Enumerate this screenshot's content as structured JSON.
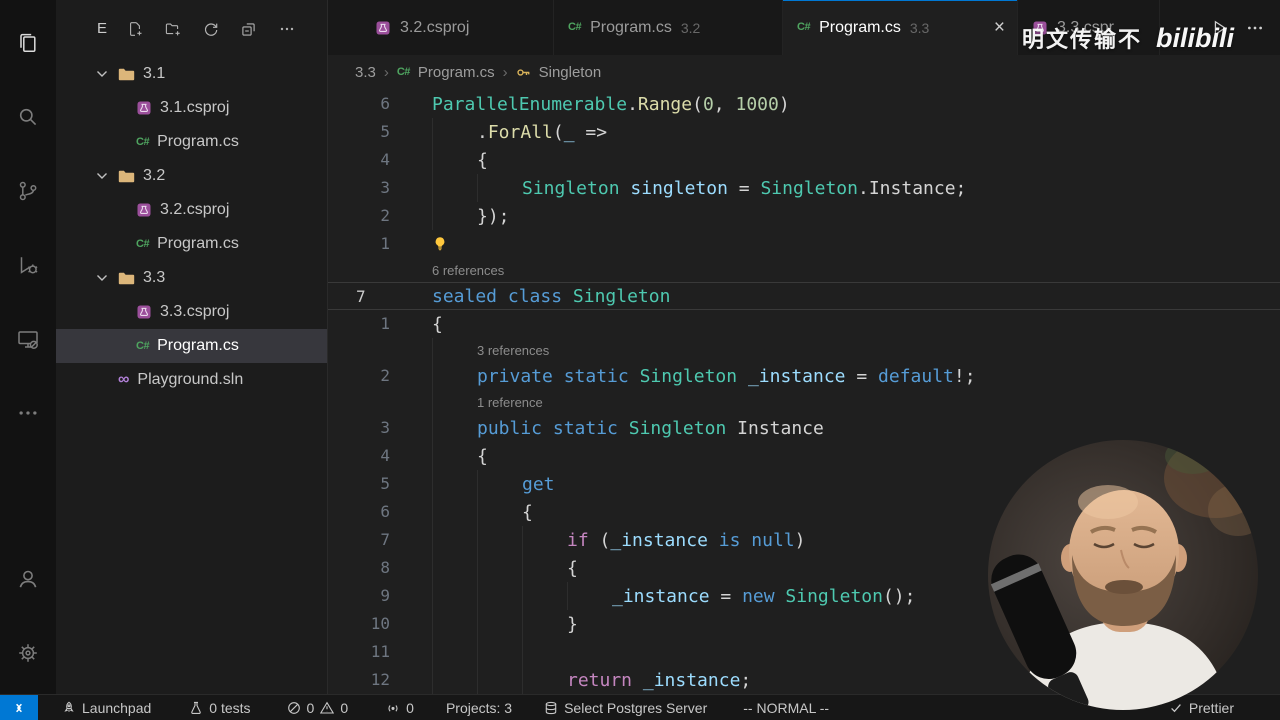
{
  "icons": {
    "cs_badge": "C#",
    "sln_badge": "∞"
  },
  "activity_bar": {
    "icons": [
      "explorer",
      "search",
      "source-control",
      "run-debug",
      "remote-explorer",
      "more"
    ],
    "bottom_icons": [
      "account",
      "settings"
    ]
  },
  "explorer": {
    "header": {
      "title": "E",
      "actions": [
        "new-file",
        "new-folder",
        "refresh",
        "collapse-all",
        "more"
      ]
    },
    "tree": [
      {
        "label": "3.1",
        "type": "folder",
        "expanded": true
      },
      {
        "label": "3.1.csproj",
        "type": "csproj"
      },
      {
        "label": "Program.cs",
        "type": "cs"
      },
      {
        "label": "3.2",
        "type": "folder",
        "expanded": true
      },
      {
        "label": "3.2.csproj",
        "type": "csproj"
      },
      {
        "label": "Program.cs",
        "type": "cs"
      },
      {
        "label": "3.3",
        "type": "folder",
        "expanded": true
      },
      {
        "label": "3.3.csproj",
        "type": "csproj"
      },
      {
        "label": "Program.cs",
        "type": "cs",
        "selected": true
      },
      {
        "label": "Playground.sln",
        "type": "sln"
      }
    ]
  },
  "tabs": [
    {
      "label": "3.2.csproj",
      "icon": "csproj",
      "active": false
    },
    {
      "label": "Program.cs",
      "hint": "3.2",
      "icon": "cs",
      "active": false
    },
    {
      "label": "Program.cs",
      "hint": "3.3",
      "icon": "cs",
      "active": true,
      "close_label": "×"
    },
    {
      "label": "3.3.cspr",
      "icon": "csproj",
      "active": false
    }
  ],
  "breadcrumb": {
    "separator": "›",
    "project": "3.3",
    "file": "Program.cs",
    "symbol": "Singleton"
  },
  "editor": {
    "token_colors": {
      "type": "#4EC9B0",
      "method": "#DCDCAA",
      "keyword": "#569CD6",
      "control": "#C586C0",
      "number": "#B5CEA8",
      "variable": "#9CDCFE",
      "plain": "#D4D4D4"
    },
    "rows": [
      {
        "num": "6",
        "indent": 0,
        "tokens": [
          [
            "ParallelEnumerable",
            "type"
          ],
          [
            ".",
            "plain"
          ],
          [
            "Range",
            "method"
          ],
          [
            "(",
            "plain"
          ],
          [
            "0",
            "number"
          ],
          [
            ", ",
            "plain"
          ],
          [
            "1000",
            "number"
          ],
          [
            ")",
            "plain"
          ]
        ]
      },
      {
        "num": "5",
        "indent": 1,
        "tokens": [
          [
            ".",
            "plain"
          ],
          [
            "ForAll",
            "method"
          ],
          [
            "(",
            "plain"
          ],
          [
            "_",
            "variable"
          ],
          [
            " =>",
            "plain"
          ]
        ]
      },
      {
        "num": "4",
        "indent": 1,
        "tokens": [
          [
            "{",
            "plain"
          ]
        ]
      },
      {
        "num": "3",
        "indent": 2,
        "tokens": [
          [
            "Singleton",
            "type"
          ],
          [
            " ",
            "plain"
          ],
          [
            "singleton",
            "variable"
          ],
          [
            " = ",
            "plain"
          ],
          [
            "Singleton",
            "type"
          ],
          [
            ".",
            "plain"
          ],
          [
            "Instance",
            "plain"
          ],
          [
            ";",
            "plain"
          ]
        ]
      },
      {
        "num": "2",
        "indent": 1,
        "tokens": [
          [
            "});",
            "plain"
          ]
        ]
      },
      {
        "num": "1",
        "indent": 0,
        "lightbulb": true,
        "tokens": []
      },
      {
        "kind": "lens",
        "indent": 0,
        "text": "6 references"
      },
      {
        "num": "7",
        "current": true,
        "indent": 0,
        "tokens": [
          [
            "sealed",
            "keyword"
          ],
          [
            " ",
            "plain"
          ],
          [
            "class",
            "keyword"
          ],
          [
            " ",
            "plain"
          ],
          [
            "Singleton",
            "type"
          ]
        ]
      },
      {
        "num": "1",
        "indent": 0,
        "tokens": [
          [
            "{",
            "plain"
          ]
        ]
      },
      {
        "kind": "lens",
        "indent": 1,
        "text": "3 references"
      },
      {
        "num": "2",
        "indent": 1,
        "tokens": [
          [
            "private",
            "keyword"
          ],
          [
            " ",
            "plain"
          ],
          [
            "static",
            "keyword"
          ],
          [
            " ",
            "plain"
          ],
          [
            "Singleton",
            "type"
          ],
          [
            " ",
            "plain"
          ],
          [
            "_instance",
            "variable"
          ],
          [
            " = ",
            "plain"
          ],
          [
            "default",
            "keyword"
          ],
          [
            "!;",
            "plain"
          ]
        ]
      },
      {
        "kind": "lens",
        "indent": 1,
        "text": "1 reference"
      },
      {
        "num": "3",
        "indent": 1,
        "tokens": [
          [
            "public",
            "keyword"
          ],
          [
            " ",
            "plain"
          ],
          [
            "static",
            "keyword"
          ],
          [
            " ",
            "plain"
          ],
          [
            "Singleton",
            "type"
          ],
          [
            " ",
            "plain"
          ],
          [
            "Instance",
            "plain"
          ]
        ]
      },
      {
        "num": "4",
        "indent": 1,
        "tokens": [
          [
            "{",
            "plain"
          ]
        ]
      },
      {
        "num": "5",
        "indent": 2,
        "tokens": [
          [
            "get",
            "keyword"
          ]
        ]
      },
      {
        "num": "6",
        "indent": 2,
        "tokens": [
          [
            "{",
            "plain"
          ]
        ]
      },
      {
        "num": "7",
        "indent": 3,
        "tokens": [
          [
            "if",
            "control"
          ],
          [
            " (",
            "plain"
          ],
          [
            "_instance",
            "variable"
          ],
          [
            " ",
            "plain"
          ],
          [
            "is",
            "keyword"
          ],
          [
            " ",
            "plain"
          ],
          [
            "null",
            "keyword"
          ],
          [
            ")",
            "plain"
          ]
        ]
      },
      {
        "num": "8",
        "indent": 3,
        "tokens": [
          [
            "{",
            "plain"
          ]
        ]
      },
      {
        "num": "9",
        "indent": 4,
        "tokens": [
          [
            "_instance",
            "variable"
          ],
          [
            " = ",
            "plain"
          ],
          [
            "new",
            "keyword"
          ],
          [
            " ",
            "plain"
          ],
          [
            "Singleton",
            "type"
          ],
          [
            "();",
            "plain"
          ]
        ]
      },
      {
        "num": "10",
        "indent": 3,
        "tokens": [
          [
            "}",
            "plain"
          ]
        ]
      },
      {
        "num": "11",
        "indent": 3,
        "tokens": []
      },
      {
        "num": "12",
        "indent": 3,
        "tokens": [
          [
            "return",
            "control"
          ],
          [
            " ",
            "plain"
          ],
          [
            "_instance",
            "variable"
          ],
          [
            ";",
            "plain"
          ]
        ]
      }
    ]
  },
  "status_bar": {
    "launchpad": "Launchpad",
    "tests": "0 tests",
    "errors": "0",
    "warnings": "0",
    "broadcast": "0",
    "projects": "Projects: 3",
    "postgres": "Select Postgres Server",
    "vim_mode": "-- NORMAL --",
    "prettier": "Prettier"
  },
  "overlay": {
    "watermark_text": "明文传输不",
    "watermark_logo": "bilibili"
  }
}
